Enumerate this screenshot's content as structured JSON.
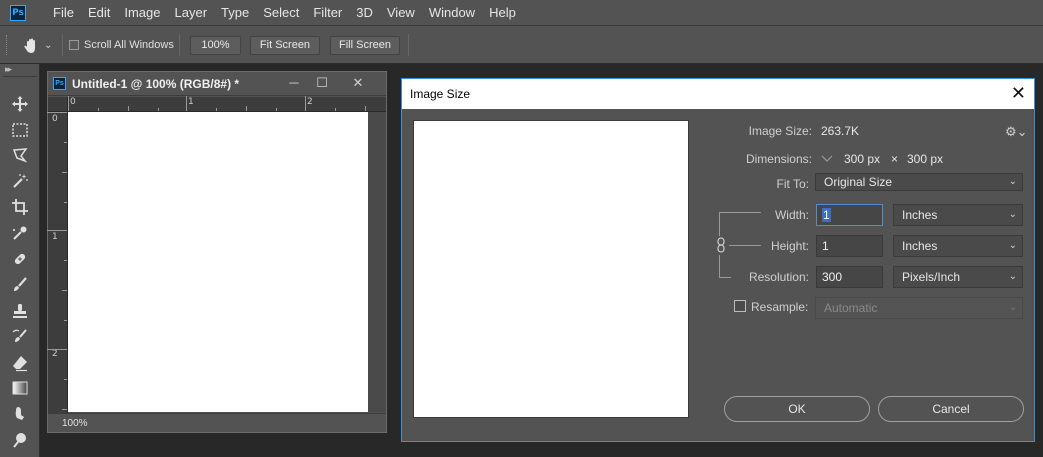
{
  "app": {
    "logo_text": "Ps"
  },
  "menu": [
    "File",
    "Edit",
    "Image",
    "Layer",
    "Type",
    "Select",
    "Filter",
    "3D",
    "View",
    "Window",
    "Help"
  ],
  "options": {
    "scroll_all_windows": "Scroll All Windows",
    "zoom_btn": "100%",
    "fit_screen": "Fit Screen",
    "fill_screen": "Fill Screen"
  },
  "tools": [
    "move-tool",
    "marquee-tool",
    "lasso-tool",
    "magic-wand-tool",
    "crop-tool",
    "eyedropper-tool",
    "healing-brush-tool",
    "brush-tool",
    "clone-stamp-tool",
    "history-brush-tool",
    "eraser-tool",
    "gradient-tool",
    "smudge-tool",
    "dodge-tool"
  ],
  "document": {
    "title": "Untitled-1 @ 100% (RGB/8#) *",
    "ruler_h": [
      "0",
      "1",
      "2"
    ],
    "ruler_v": [
      "0",
      "1",
      "2"
    ],
    "zoom_status": "100%"
  },
  "dialog": {
    "title": "Image Size",
    "image_size_label": "Image Size:",
    "image_size_value": "263.7K",
    "dimensions_label": "Dimensions:",
    "dim_width": "300 px",
    "dim_x": "×",
    "dim_height": "300 px",
    "fit_to_label": "Fit To:",
    "fit_to_value": "Original Size",
    "width_label": "Width:",
    "width_value": "1",
    "width_unit": "Inches",
    "height_label": "Height:",
    "height_value": "1",
    "height_unit": "Inches",
    "resolution_label": "Resolution:",
    "resolution_value": "300",
    "resolution_unit": "Pixels/Inch",
    "resample_label": "Resample:",
    "resample_value": "Automatic",
    "ok": "OK",
    "cancel": "Cancel"
  }
}
